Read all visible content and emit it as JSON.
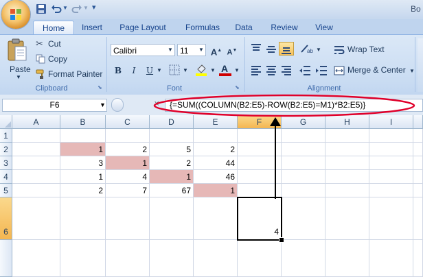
{
  "window": {
    "title": "Bo"
  },
  "tabs": [
    "Home",
    "Insert",
    "Page Layout",
    "Formulas",
    "Data",
    "Review",
    "View"
  ],
  "clipboard": {
    "paste": "Paste",
    "cut": "Cut",
    "copy": "Copy",
    "format_painter": "Format Painter",
    "group": "Clipboard"
  },
  "font": {
    "name": "Calibri",
    "size": "11",
    "group": "Font",
    "bold": "B",
    "italic": "I",
    "underline": "U",
    "grow": "A",
    "shrink": "A",
    "color_letter": "A",
    "font_color": "#d00000",
    "fill_color": "#ffff00"
  },
  "alignment": {
    "wrap_text": "Wrap Text",
    "merge_center": "Merge & Center",
    "group": "Alignment"
  },
  "formula_bar": {
    "name_box": "F6",
    "fx": "fx",
    "formula": "{=SUM((COLUMN(B2:E5)-ROW(B2:E5)=M1)*B2:E5)}"
  },
  "columns": [
    "A",
    "B",
    "C",
    "D",
    "E",
    "F",
    "G",
    "H",
    "I"
  ],
  "rows": [
    "1",
    "2",
    "3",
    "4",
    "5",
    "6"
  ],
  "cells": {
    "B2": "1",
    "C2": "2",
    "D2": "5",
    "E2": "2",
    "B3": "3",
    "C3": "1",
    "D3": "2",
    "E3": "44",
    "B4": "1",
    "C4": "4",
    "D4": "1",
    "E4": "46",
    "B5": "2",
    "C5": "7",
    "D5": "67",
    "E5": "1",
    "F6": "4"
  },
  "colors": {
    "highlight": "#e6b8b7",
    "annotation": "#e0002a",
    "selected_header": "#f8c56d"
  }
}
